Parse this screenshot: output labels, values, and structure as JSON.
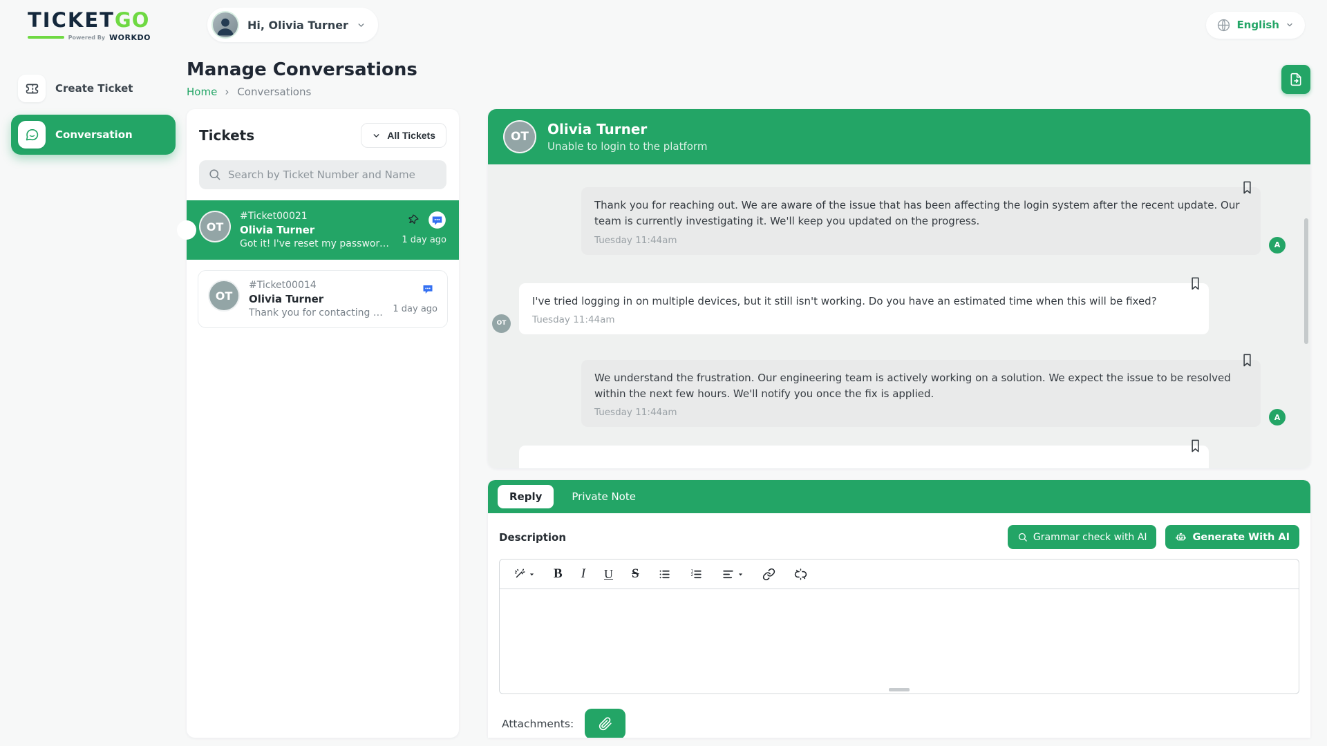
{
  "brand": {
    "logo_part1": "TICKET",
    "logo_part2": "GO",
    "tagline_prefix": "Powered By",
    "tagline_brand": "WORKDO"
  },
  "header": {
    "greeting": "Hi, Olivia Turner",
    "language": "English"
  },
  "sidebar": {
    "items": [
      {
        "label": "Create Ticket",
        "active": false
      },
      {
        "label": "Conversation",
        "active": true
      }
    ]
  },
  "page": {
    "title": "Manage Conversations",
    "breadcrumb_home": "Home",
    "breadcrumb_current": "Conversations"
  },
  "tickets_panel": {
    "title": "Tickets",
    "filter_label": "All Tickets",
    "search_placeholder": "Search by Ticket Number and Name",
    "items": [
      {
        "number": "#Ticket00021",
        "name": "Olivia Turner",
        "initials": "OT",
        "preview": "Got it! I've reset my password...",
        "time": "1 day ago",
        "selected": true,
        "pinned": true
      },
      {
        "number": "#Ticket00014",
        "name": "Olivia Turner",
        "initials": "OT",
        "preview": "Thank you for contacting us! O...",
        "time": "1 day ago",
        "selected": false,
        "pinned": false
      }
    ]
  },
  "chat": {
    "contact_name": "Olivia Turner",
    "contact_initials": "OT",
    "subject": "Unable to login to the platform",
    "messages": [
      {
        "author_initial": "A",
        "side": "agent",
        "text": "Thank you for reaching out. We are aware of the issue that has been affecting the login system after the recent update. Our team is currently investigating it. We'll keep you updated on the progress.",
        "time": "Tuesday 11:44am"
      },
      {
        "author_initial": "OT",
        "side": "user",
        "text": "I've tried logging in on multiple devices, but it still isn't working. Do you have an estimated time when this will be fixed?",
        "time": "Tuesday 11:44am"
      },
      {
        "author_initial": "A",
        "side": "agent",
        "text": "We understand the frustration. Our engineering team is actively working on a solution. We expect the issue to be resolved within the next few hours. We'll notify you once the fix is applied.",
        "time": "Tuesday 11:44am"
      }
    ]
  },
  "reply_panel": {
    "tab_reply": "Reply",
    "tab_private_note": "Private Note",
    "description_label": "Description",
    "grammar_button_label": "Grammar check with AI",
    "generate_button_label": "Generate With AI",
    "attachments_label": "Attachments:"
  },
  "colors": {
    "primary_green": "#23a566",
    "logo_green": "#6fd943",
    "logo_navy": "#14283c",
    "message_blue": "#3470f2",
    "avatar_gray": "#93a5a6",
    "chat_background": "#eff1f0",
    "bubble_gray": "#e9eaea"
  }
}
